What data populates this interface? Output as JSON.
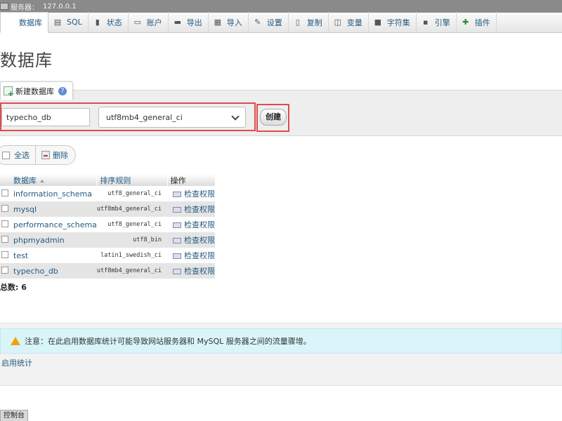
{
  "server_bar": {
    "label": "服务器：",
    "host": "127.0.0.1"
  },
  "tabs": [
    {
      "label": "数据库",
      "icon": "database-icon",
      "glyph": "",
      "active": true
    },
    {
      "label": "SQL",
      "icon": "sql-icon",
      "glyph": "▤"
    },
    {
      "label": "状态",
      "icon": "status-icon",
      "glyph": "▮"
    },
    {
      "label": "账户",
      "icon": "accounts-icon",
      "glyph": "▭"
    },
    {
      "label": "导出",
      "icon": "export-icon",
      "glyph": "▬"
    },
    {
      "label": "导入",
      "icon": "import-icon",
      "glyph": "▦"
    },
    {
      "label": "设置",
      "icon": "settings-icon",
      "glyph": "✎"
    },
    {
      "label": "复制",
      "icon": "replication-icon",
      "glyph": "▯"
    },
    {
      "label": "变量",
      "icon": "variables-icon",
      "glyph": "◫"
    },
    {
      "label": "字符集",
      "icon": "charset-icon",
      "glyph": "■"
    },
    {
      "label": "引擎",
      "icon": "engines-icon",
      "glyph": "▪"
    },
    {
      "label": "插件",
      "icon": "plugins-icon",
      "glyph": "✚"
    }
  ],
  "page_title": "数据库",
  "create_db": {
    "legend": "新建数据库",
    "name_value": "typecho_db",
    "collation_value": "utf8mb4_general_ci",
    "create_label": "创建"
  },
  "bulk": {
    "select_all_label": "全选",
    "delete_label": "删除"
  },
  "table": {
    "headers": {
      "name": "数据库",
      "collation": "排序规则",
      "action": "操作"
    },
    "rows": [
      {
        "name": "information_schema",
        "collation": "utf8_general_ci",
        "action": "检查权限"
      },
      {
        "name": "mysql",
        "collation": "utf8mb4_general_ci",
        "action": "检查权限"
      },
      {
        "name": "performance_schema",
        "collation": "utf8_general_ci",
        "action": "检查权限"
      },
      {
        "name": "phpmyadmin",
        "collation": "utf8_bin",
        "action": "检查权限"
      },
      {
        "name": "test",
        "collation": "latin1_swedish_ci",
        "action": "检查权限"
      },
      {
        "name": "typecho_db",
        "collation": "utf8mb4_general_ci",
        "action": "检查权限"
      }
    ],
    "total": "总数:  6"
  },
  "notice": "注意：在此启用数据库统计可能导致网站服务器和 MySQL 服务器之间的流量骤增。",
  "enable_stats_label": "启用统计",
  "console_label": "控制台",
  "colors": {
    "highlight": "#e04b4b",
    "link": "#235a81",
    "notice_bg": "#d9f5fa",
    "warning": "#f0a500"
  }
}
